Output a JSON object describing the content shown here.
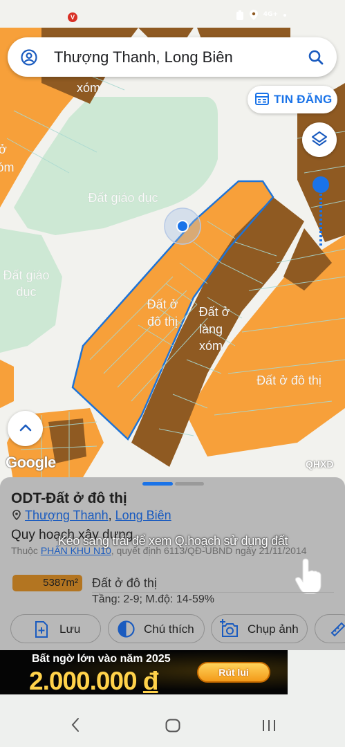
{
  "status_bar": {
    "network": "4G+",
    "badge": "V"
  },
  "search": {
    "query": "Thượng Thanh, Long Biên"
  },
  "tin_dang": {
    "label": "TIN ĐĂNG"
  },
  "map": {
    "labels": {
      "xom_top": "xóm",
      "o_left": "ở",
      "om_left": "óm",
      "giao_duc": "Đất giáo dục",
      "giao_duc_left_1": "Đất giáo",
      "giao_duc_left_2": "dục",
      "do_thi_1": "Đất ở",
      "do_thi_2": "đô thị",
      "lang_xom_1": "Đất ở",
      "lang_xom_2": "làng",
      "lang_xom_3": "xóm",
      "do_thi_right": "Đất ở đô thị"
    },
    "google": "Google",
    "qhxd": "QHXD",
    "colors": {
      "residential": "#f7a03a",
      "village": "#8f5a22",
      "education": "#cde8d4",
      "road": "#f2f2ee",
      "outline": "#1e73d6"
    }
  },
  "panel": {
    "title": "ODT-Đất ở đô thị",
    "location": {
      "ward": "Thượng Thanh",
      "separator": ", ",
      "district": "Long Biên"
    },
    "planning_label": "Quy hoạch xây dựng",
    "belongs_prefix": "Thuộc ",
    "belongs_link": "PHÂN KHU N10",
    "belongs_suffix": ", quyết định 6113/QĐ-UBND ngày 21/11/2014",
    "hint": "Kéo sang trái để xem Q.hoạch sử dụng đất",
    "area": "5387m²",
    "land_type": "Đất ở đô thị",
    "floors": "Tầng: 2-9; M.độ: 14-59%",
    "actions": {
      "save": "Lưu",
      "legend": "Chú thích",
      "capture": "Chụp ảnh"
    }
  },
  "ad": {
    "line1": "Bất ngờ lớn vào năm 2025",
    "amount": "2.000.000",
    "currency": "đ",
    "button": "Rút lui"
  }
}
